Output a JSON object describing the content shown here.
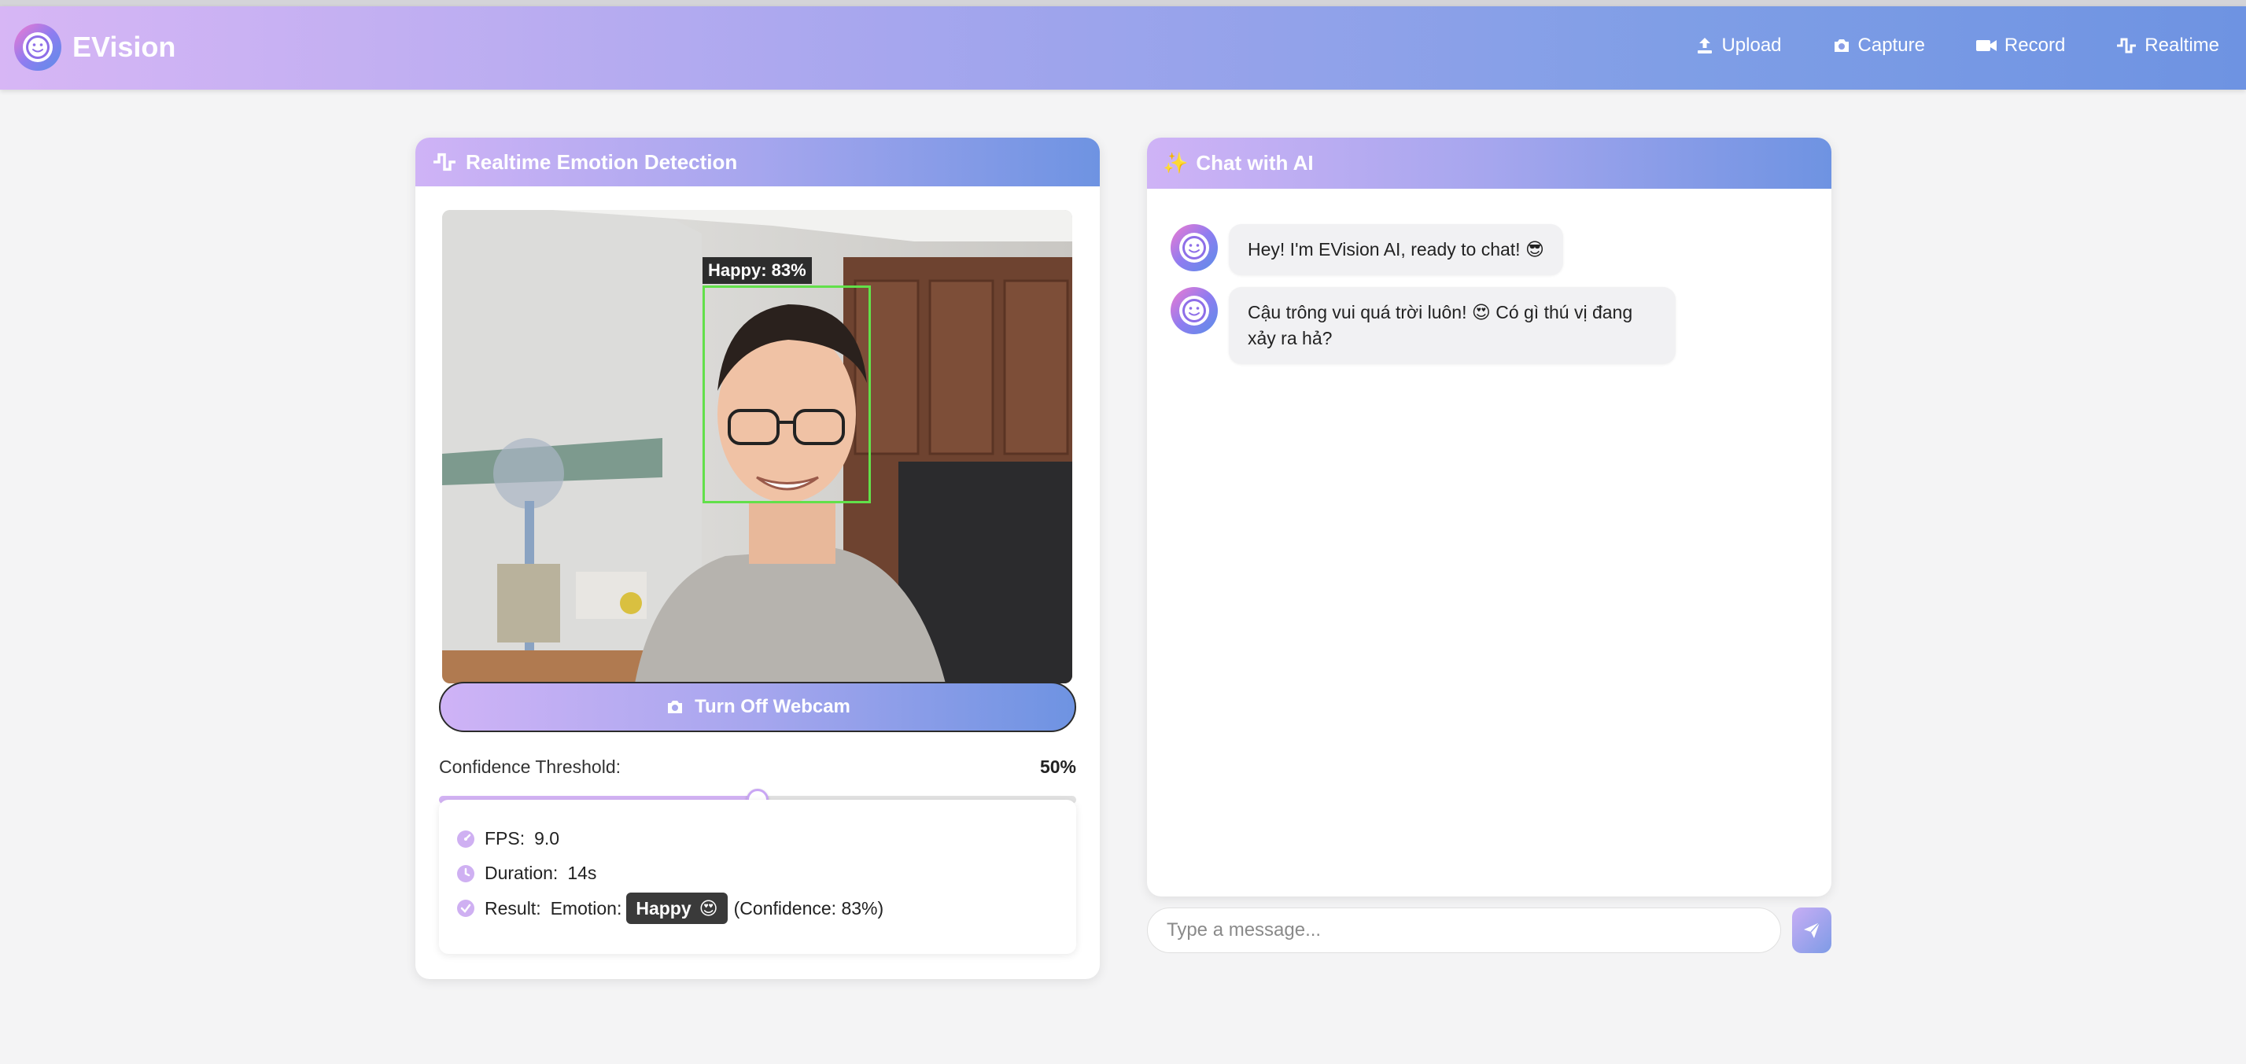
{
  "app": {
    "name": "EVision"
  },
  "nav": {
    "items": [
      {
        "label": "Upload",
        "icon": "upload-icon"
      },
      {
        "label": "Capture",
        "icon": "camera-icon"
      },
      {
        "label": "Record",
        "icon": "video-icon"
      },
      {
        "label": "Realtime",
        "icon": "pulse-icon"
      }
    ]
  },
  "detection": {
    "title": "Realtime Emotion Detection",
    "face_label": "Happy: 83%",
    "webcam_button": "Turn Off Webcam",
    "threshold_label": "Confidence Threshold:",
    "threshold_value": "50%",
    "threshold": 0.5,
    "stats": {
      "fps_label": "FPS:",
      "fps_value": "9.0",
      "duration_label": "Duration:",
      "duration_value": "14s",
      "result_label": "Result:",
      "emotion_label": "Emotion:",
      "emotion_value": "Happy",
      "emotion_emoji": "😍",
      "confidence_text": "(Confidence: 83%)"
    }
  },
  "chat": {
    "title": "Chat with AI",
    "title_emoji": "✨",
    "messages": [
      {
        "text": "Hey! I'm EVision AI, ready to chat! 😎"
      },
      {
        "text": "Cậu trông vui quá trời luôn! 😍 Có gì thú vị đang xảy ra hả?"
      }
    ],
    "input_placeholder": "Type a message..."
  },
  "colors": {
    "accent_purple": "#cfb3f6",
    "accent_blue": "#6e93e2",
    "face_box": "#62e04a"
  }
}
